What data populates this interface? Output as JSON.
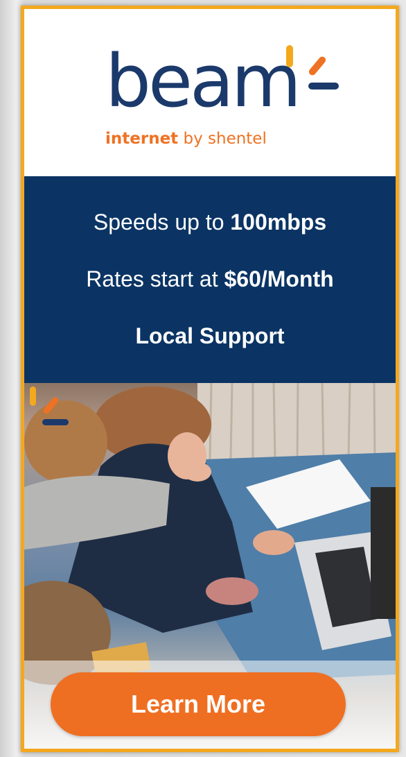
{
  "brand": {
    "name": "beam",
    "tagline_bold": "internet",
    "tagline_rest": " by shentel"
  },
  "features": {
    "line1_prefix": "Speeds up to ",
    "line1_value": "100mbps",
    "line2_prefix": "Rates start at ",
    "line2_value": "$60/Month",
    "line3": "Local Support"
  },
  "cta": {
    "label": "Learn More"
  },
  "colors": {
    "navy": "#0b3464",
    "orange": "#ef6f22",
    "border_yellow": "#f4a81e"
  },
  "photo": {
    "subject": "family-with-laptop-photo"
  }
}
